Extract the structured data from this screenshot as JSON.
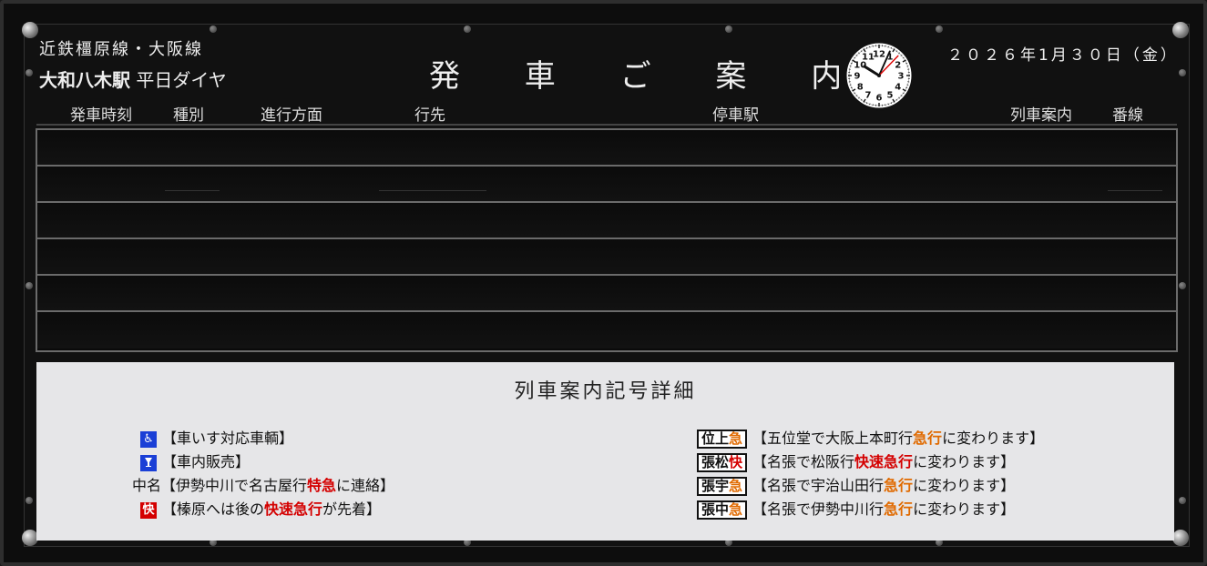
{
  "header": {
    "line_name": "近鉄橿原線・大阪線",
    "station_name": "大和八木駅",
    "schedule": "平日ダイヤ",
    "title": "発 車 ご 案 内",
    "date": "２０２６年1月３０日（金）",
    "clock": {
      "hour": 10,
      "minute": 4,
      "second": 4,
      "numerals": [
        "12",
        "1",
        "2",
        "3",
        "4",
        "5",
        "6",
        "7",
        "8",
        "9",
        "10",
        "11"
      ]
    }
  },
  "columns": [
    "発車時刻",
    "種別",
    "進行方面",
    "行先",
    "停車駅",
    "列車案内",
    "番線"
  ],
  "rows": [
    {},
    {},
    {},
    {},
    {},
    {}
  ],
  "legend": {
    "title": "列車案内記号詳細",
    "left_items": [
      {
        "symbol": "♿",
        "symbol_style": "blue",
        "icon": "wheelchair-icon",
        "parts": [
          {
            "t": "【車いす対応車輌】",
            "s": ""
          }
        ]
      },
      {
        "symbol": "🍸",
        "symbol_style": "blue",
        "icon": "onboard-sales-icon",
        "parts": [
          {
            "t": "【車内販売】",
            "s": ""
          }
        ]
      },
      {
        "symbol": "中名",
        "symbol_style": "text",
        "icon": "",
        "parts": [
          {
            "t": "【伊勢中川で名古屋行",
            "s": ""
          },
          {
            "t": "特急",
            "s": "red"
          },
          {
            "t": "に連絡】",
            "s": ""
          }
        ]
      },
      {
        "symbol": "快",
        "symbol_style": "red",
        "icon": "",
        "parts": [
          {
            "t": "【榛原へは後の",
            "s": ""
          },
          {
            "t": "快速急行",
            "s": "red"
          },
          {
            "t": "が先着】",
            "s": ""
          }
        ]
      }
    ],
    "right_items": [
      {
        "tag": [
          {
            "t": "位上",
            "s": ""
          },
          {
            "t": "急",
            "s": "orange"
          }
        ],
        "parts": [
          {
            "t": "【五位堂で大阪上本町行",
            "s": ""
          },
          {
            "t": "急行",
            "s": "orange"
          },
          {
            "t": "に変わります】",
            "s": ""
          }
        ]
      },
      {
        "tag": [
          {
            "t": "張松",
            "s": ""
          },
          {
            "t": "快",
            "s": "red"
          }
        ],
        "parts": [
          {
            "t": "【名張で松阪行",
            "s": ""
          },
          {
            "t": "快速急行",
            "s": "red"
          },
          {
            "t": "に変わります】",
            "s": ""
          }
        ]
      },
      {
        "tag": [
          {
            "t": "張宇",
            "s": ""
          },
          {
            "t": "急",
            "s": "orange"
          }
        ],
        "parts": [
          {
            "t": "【名張で宇治山田行",
            "s": ""
          },
          {
            "t": "急行",
            "s": "orange"
          },
          {
            "t": "に変わります】",
            "s": ""
          }
        ]
      },
      {
        "tag": [
          {
            "t": "張中",
            "s": ""
          },
          {
            "t": "急",
            "s": "orange"
          }
        ],
        "parts": [
          {
            "t": "【名張で伊勢中川行",
            "s": ""
          },
          {
            "t": "急行",
            "s": "orange"
          },
          {
            "t": "に変わります】",
            "s": ""
          }
        ]
      }
    ]
  },
  "colors": {
    "board": "#0d0d0d",
    "legend_bg": "#e6e6e8",
    "express_orange": "#e06a00",
    "rapid_red": "#d40000",
    "symbol_blue": "#1a3fd6"
  }
}
